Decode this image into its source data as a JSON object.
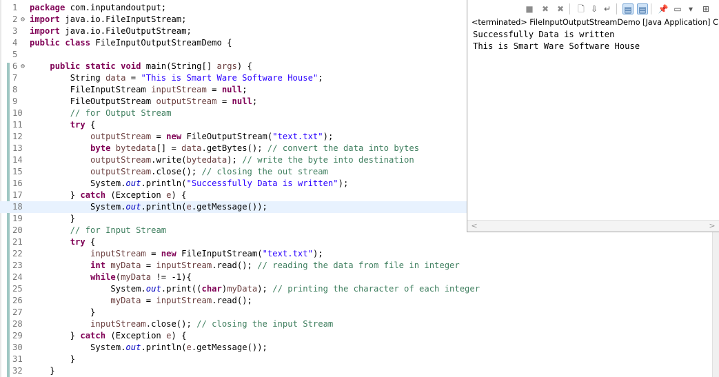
{
  "editor": {
    "lines": [
      {
        "n": "1",
        "fold": "",
        "html": "<span class='kw'>package</span> com.inputandoutput;"
      },
      {
        "n": "2",
        "fold": "⊖",
        "html": "<span class='kw'>import</span> java.io.FileInputStream;"
      },
      {
        "n": "3",
        "fold": "",
        "html": "<span class='kw'>import</span> java.io.FileOutputStream;"
      },
      {
        "n": "4",
        "fold": "",
        "html": "<span class='kw'>public</span> <span class='kw'>class</span> FileInputOutputStreamDemo {"
      },
      {
        "n": "5",
        "fold": "",
        "html": ""
      },
      {
        "n": "6",
        "fold": "⊖",
        "html": "    <span class='kw'>public</span> <span class='kw'>static</span> <span class='kw'>void</span> main(String[] <span class='var'>args</span>) {"
      },
      {
        "n": "7",
        "fold": "",
        "html": "        String <span class='var'>data</span> = <span class='str'>\"This is Smart Ware Software House\"</span>;"
      },
      {
        "n": "8",
        "fold": "",
        "html": "        FileInputStream <span class='var'>inputStream</span> = <span class='kw'>null</span>;"
      },
      {
        "n": "9",
        "fold": "",
        "html": "        FileOutputStream <span class='var'>outputStream</span> = <span class='kw'>null</span>;"
      },
      {
        "n": "10",
        "fold": "",
        "html": "        <span class='cm'>// for Output Stream</span>"
      },
      {
        "n": "11",
        "fold": "",
        "html": "        <span class='kw'>try</span> {"
      },
      {
        "n": "12",
        "fold": "",
        "html": "            <span class='var'>outputStream</span> = <span class='kw'>new</span> FileOutputStream(<span class='str'>\"text.txt\"</span>);"
      },
      {
        "n": "13",
        "fold": "",
        "html": "            <span class='kw'>byte</span> <span class='var'>bytedata</span>[] = <span class='var'>data</span>.getBytes(); <span class='cm'>// convert the data into bytes</span>"
      },
      {
        "n": "14",
        "fold": "",
        "html": "            <span class='var'>outputStream</span>.write(<span class='var'>bytedata</span>); <span class='cm'>// write the byte into destination</span>"
      },
      {
        "n": "15",
        "fold": "",
        "html": "            <span class='var'>outputStream</span>.close(); <span class='cm'>// closing the out stream</span>"
      },
      {
        "n": "16",
        "fold": "",
        "html": "            System.<span class='fld'>out</span>.println(<span class='str'>\"Successfully Data is written\"</span>);"
      },
      {
        "n": "17",
        "fold": "",
        "html": "        } <span class='kw'>catch</span> (Exception <span class='var'>e</span>) {"
      },
      {
        "n": "18",
        "fold": "",
        "html": "            System.<span class='fld'>out</span>.println(<span class='var'>e</span>.getMessage());",
        "current": true
      },
      {
        "n": "19",
        "fold": "",
        "html": "        }"
      },
      {
        "n": "20",
        "fold": "",
        "html": "        <span class='cm'>// for Input Stream</span>"
      },
      {
        "n": "21",
        "fold": "",
        "html": "        <span class='kw'>try</span> {"
      },
      {
        "n": "22",
        "fold": "",
        "html": "            <span class='var'>inputStream</span> = <span class='kw'>new</span> FileInputStream(<span class='str'>\"text.txt\"</span>);"
      },
      {
        "n": "23",
        "fold": "",
        "html": "            <span class='kw'>int</span> <span class='var'>myData</span> = <span class='var'>inputStream</span>.read(); <span class='cm'>// reading the data from file in integer</span>"
      },
      {
        "n": "24",
        "fold": "",
        "html": "            <span class='kw'>while</span>(<span class='var'>myData</span> != -1){"
      },
      {
        "n": "25",
        "fold": "",
        "html": "                System.<span class='fld'>out</span>.print((<span class='kw'>char</span>)<span class='var'>myData</span>); <span class='cm'>// printing the character of each integer</span>"
      },
      {
        "n": "26",
        "fold": "",
        "html": "                <span class='var'>myData</span> = <span class='var'>inputStream</span>.read();"
      },
      {
        "n": "27",
        "fold": "",
        "html": "            }"
      },
      {
        "n": "28",
        "fold": "",
        "html": "            <span class='var'>inputStream</span>.close(); <span class='cm'>// closing the input Stream</span>"
      },
      {
        "n": "29",
        "fold": "",
        "html": "        } <span class='kw'>catch</span> (Exception <span class='var'>e</span>) {"
      },
      {
        "n": "30",
        "fold": "",
        "html": "            System.<span class='fld'>out</span>.println(<span class='var'>e</span>.getMessage());"
      },
      {
        "n": "31",
        "fold": "",
        "html": "        }"
      },
      {
        "n": "32",
        "fold": "",
        "html": "    }"
      }
    ]
  },
  "console": {
    "description": "<terminated> FileInputOutputStreamDemo [Java Application] C:\\Pro",
    "output": [
      "Successfully Data is written",
      "This is Smart Ware Software House"
    ],
    "toolbar_icons": [
      {
        "name": "terminate-icon",
        "glyph": "■",
        "style": "gray"
      },
      {
        "name": "remove-launch-icon",
        "glyph": "✖",
        "style": "gray"
      },
      {
        "name": "remove-all-terminated-icon",
        "glyph": "✖",
        "style": "gray"
      },
      {
        "name": "clear-console-icon",
        "glyph": "🗋",
        "style": ""
      },
      {
        "name": "scroll-lock-icon",
        "glyph": "⇩",
        "style": ""
      },
      {
        "name": "word-wrap-icon",
        "glyph": "↵",
        "style": ""
      },
      {
        "name": "show-console-stdout-icon",
        "glyph": "▤",
        "style": "sel"
      },
      {
        "name": "show-console-stderr-icon",
        "glyph": "▤",
        "style": "sel"
      },
      {
        "name": "pin-console-icon",
        "glyph": "📌",
        "style": ""
      },
      {
        "name": "display-console-icon",
        "glyph": "▭",
        "style": ""
      },
      {
        "name": "dropdown-icon",
        "glyph": "▾",
        "style": ""
      },
      {
        "name": "open-console-icon",
        "glyph": "⊞",
        "style": ""
      }
    ],
    "scroll_left": "<",
    "scroll_right": ">"
  }
}
